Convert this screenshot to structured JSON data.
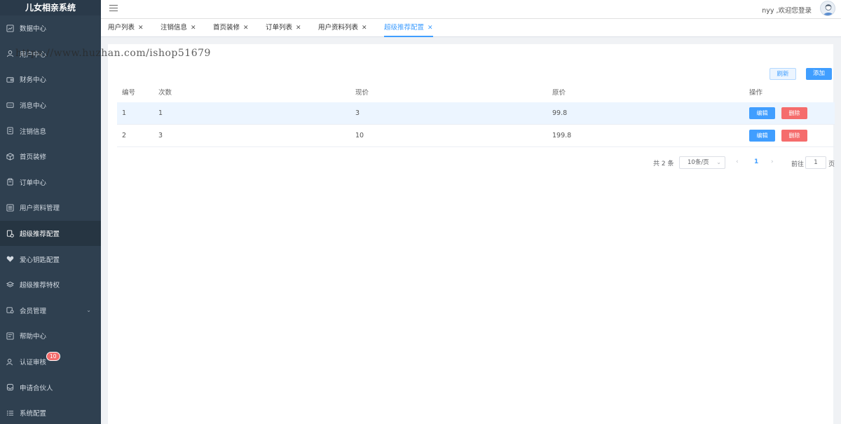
{
  "app": {
    "title": "儿女相亲系统"
  },
  "sidebar": {
    "items": [
      {
        "label": "数据中心",
        "icon": "dashboard-icon"
      },
      {
        "label": "用户中心",
        "icon": "user-icon"
      },
      {
        "label": "财务中心",
        "icon": "wallet-icon"
      },
      {
        "label": "消息中心",
        "icon": "message-icon"
      },
      {
        "label": "注销信息",
        "icon": "document-icon"
      },
      {
        "label": "首页装修",
        "icon": "box-icon"
      },
      {
        "label": "订单中心",
        "icon": "clipboard-icon"
      },
      {
        "label": "用户资料管理",
        "icon": "list-icon"
      },
      {
        "label": "超级推荐配置",
        "icon": "settings-doc-icon"
      },
      {
        "label": "爱心钥匙配置",
        "icon": "heart-icon"
      },
      {
        "label": "超级推荐特权",
        "icon": "layers-icon"
      },
      {
        "label": "会员管理",
        "icon": "member-icon"
      },
      {
        "label": "帮助中心",
        "icon": "help-doc-icon"
      },
      {
        "label": "认证审核",
        "icon": "user-check-icon",
        "badge": "10"
      },
      {
        "label": "申请合伙人",
        "icon": "inbox-icon"
      },
      {
        "label": "系统配置",
        "icon": "menu-list-icon"
      }
    ]
  },
  "header": {
    "user_text": "nyy ,欢迎您登录"
  },
  "tabs": [
    {
      "label": "用户列表"
    },
    {
      "label": "注销信息"
    },
    {
      "label": "首页装修"
    },
    {
      "label": "订单列表"
    },
    {
      "label": "用户资料列表"
    },
    {
      "label": "超级推荐配置",
      "active": true
    }
  ],
  "toolbar": {
    "refresh_label": "刷新",
    "add_label": "添加"
  },
  "table": {
    "columns": [
      "编号",
      "次数",
      "现价",
      "原价",
      "操作"
    ],
    "rows": [
      {
        "id": "1",
        "count": "1",
        "price": "3",
        "original": "99.8"
      },
      {
        "id": "2",
        "count": "3",
        "price": "10",
        "original": "199.8"
      }
    ],
    "edit_label": "编辑",
    "delete_label": "删除"
  },
  "pagination": {
    "total": "共 2 条",
    "page_size": "10条/页",
    "current": "1",
    "goto_label": "前往",
    "goto_value": "1",
    "page_suffix": "页"
  },
  "watermark": "https://www.huzhan.com/ishop51679",
  "colors": {
    "sidebar": "#2f4050",
    "primary": "#409eff",
    "danger": "#f56c6c"
  }
}
